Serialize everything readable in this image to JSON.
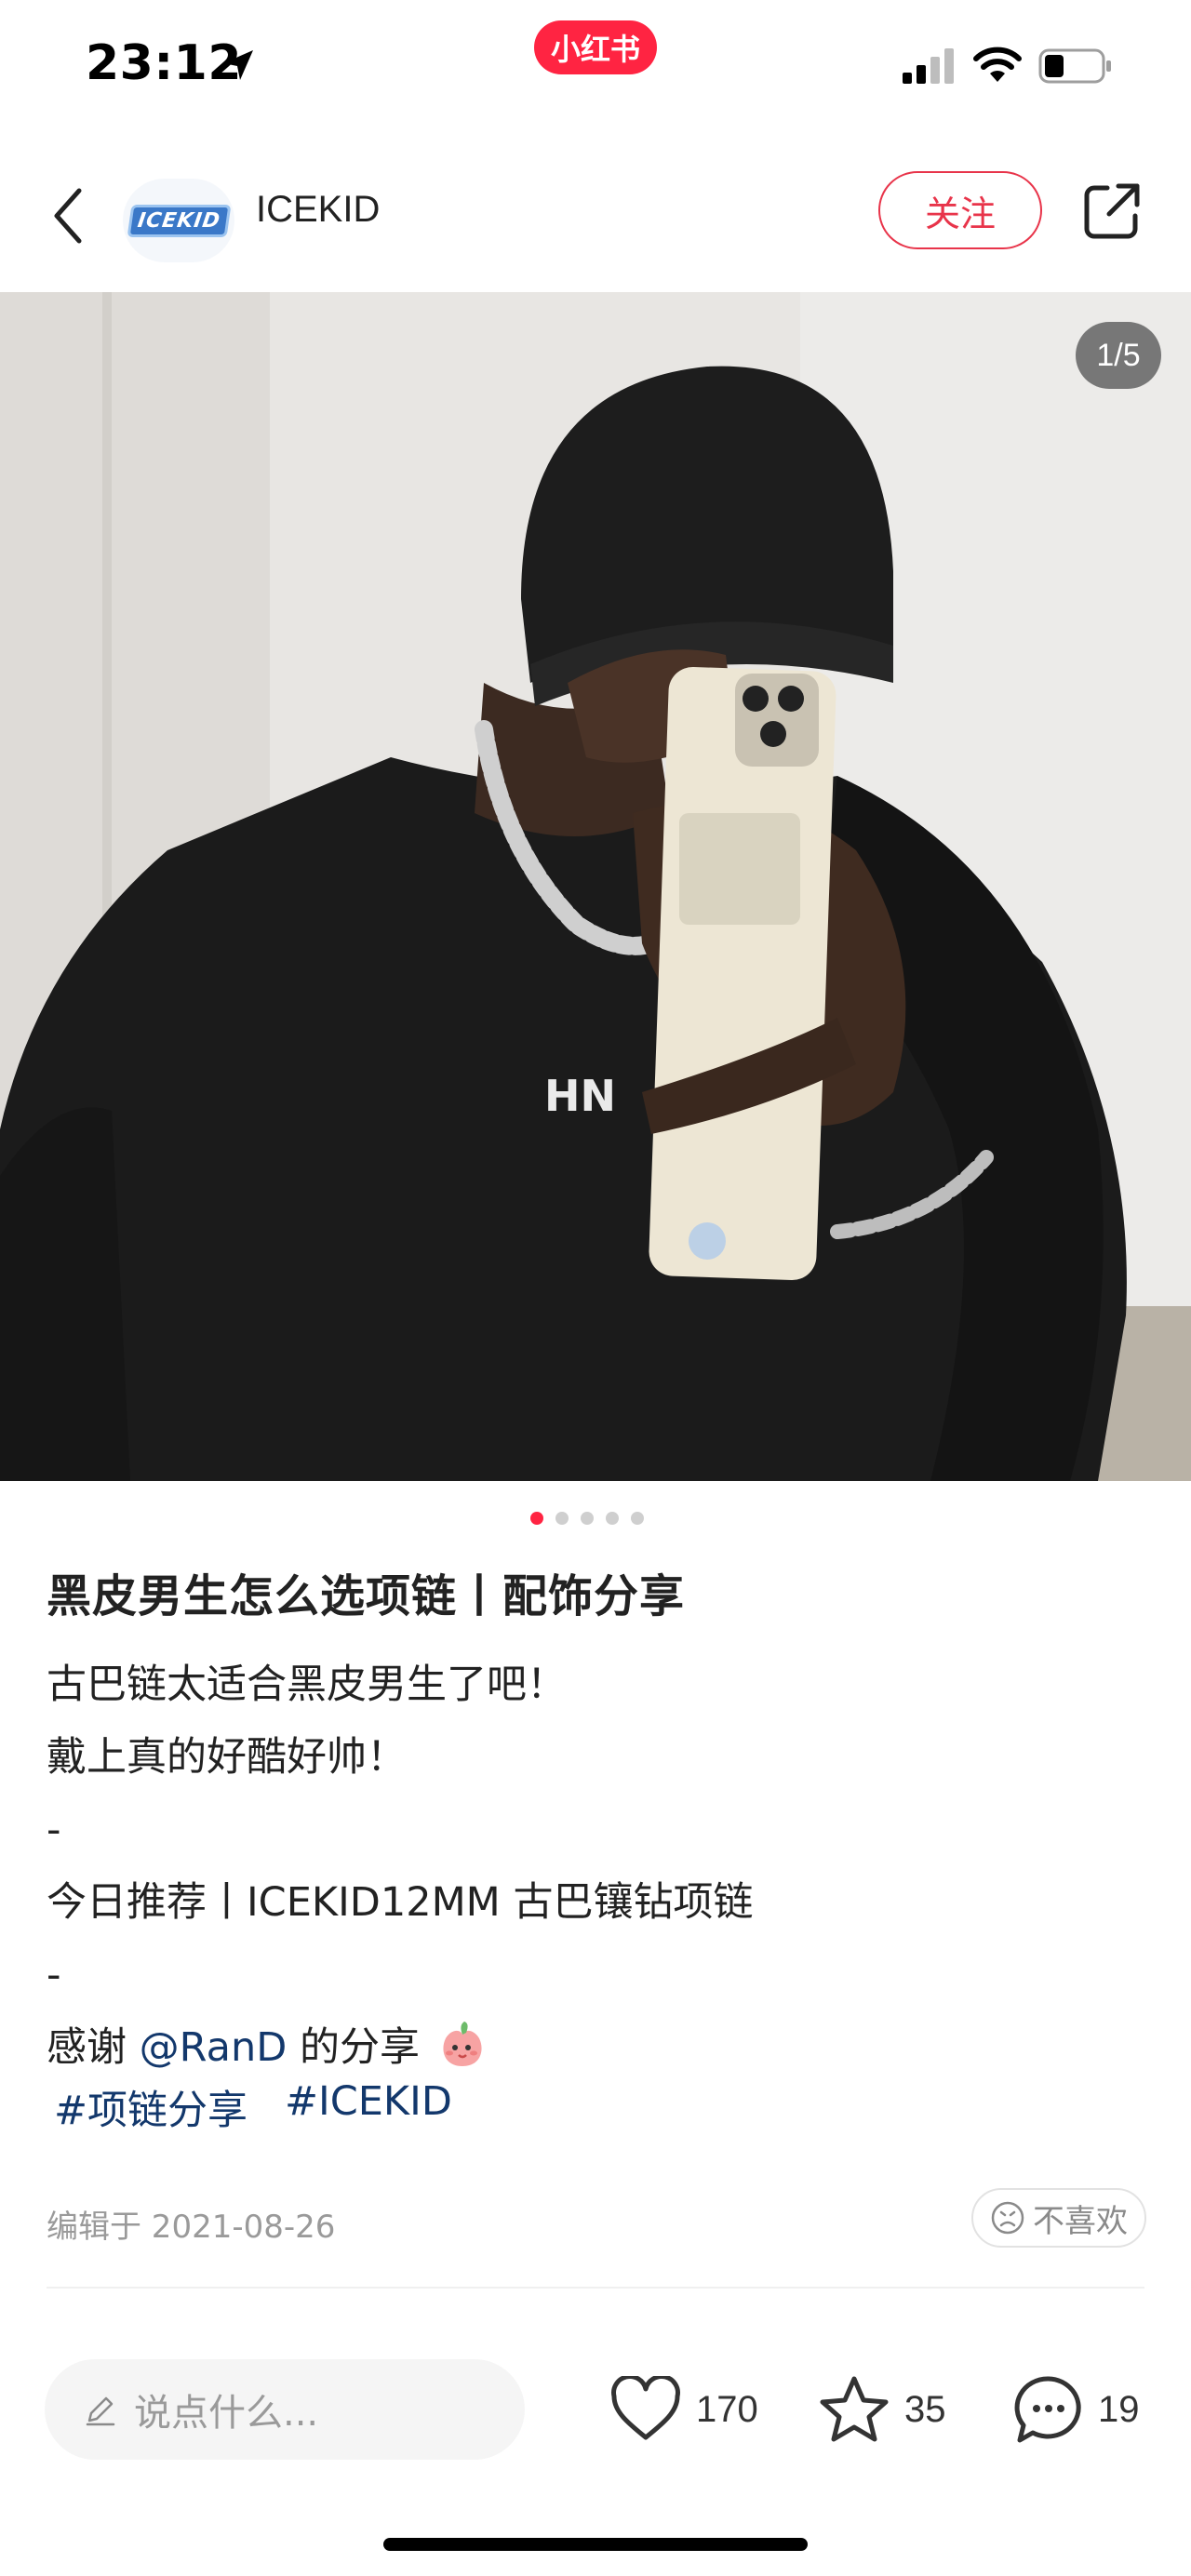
{
  "status_bar": {
    "time": "23:12",
    "app_badge": "小红书",
    "icons": [
      "location-arrow-icon",
      "cellular-signal-icon",
      "wifi-icon",
      "battery-icon"
    ]
  },
  "header": {
    "back_icon": "chevron-left-icon",
    "author_name": "ICEKID",
    "avatar_logo_text": "ICEKID",
    "follow_label": "关注",
    "share_icon": "share-icon"
  },
  "carousel": {
    "page_counter": "1/5",
    "current_page": 1,
    "total_pages": 5
  },
  "note": {
    "title": "黑皮男生怎么选项链丨配饰分享",
    "lines": [
      "古巴链太适合黑皮男生了吧！",
      "戴上真的好酷好帅！",
      "-",
      "今日推荐丨ICEKID12MM 古巴镶钻项链",
      "-"
    ],
    "thanks_prefix": "感谢 ",
    "thanks_mention": "@RanD",
    "thanks_suffix": " 的分享",
    "tags": [
      "#项链分享",
      "#ICEKID"
    ],
    "edit_date": "编辑于 2021-08-26",
    "dislike_label": "不喜欢"
  },
  "bottom_bar": {
    "comment_placeholder": "说点什么...",
    "likes": "170",
    "collects": "35",
    "comments": "19"
  },
  "colors": {
    "brand_red": "#ff2442",
    "mention_blue": "#13386c",
    "follow_red": "#e8344a"
  }
}
